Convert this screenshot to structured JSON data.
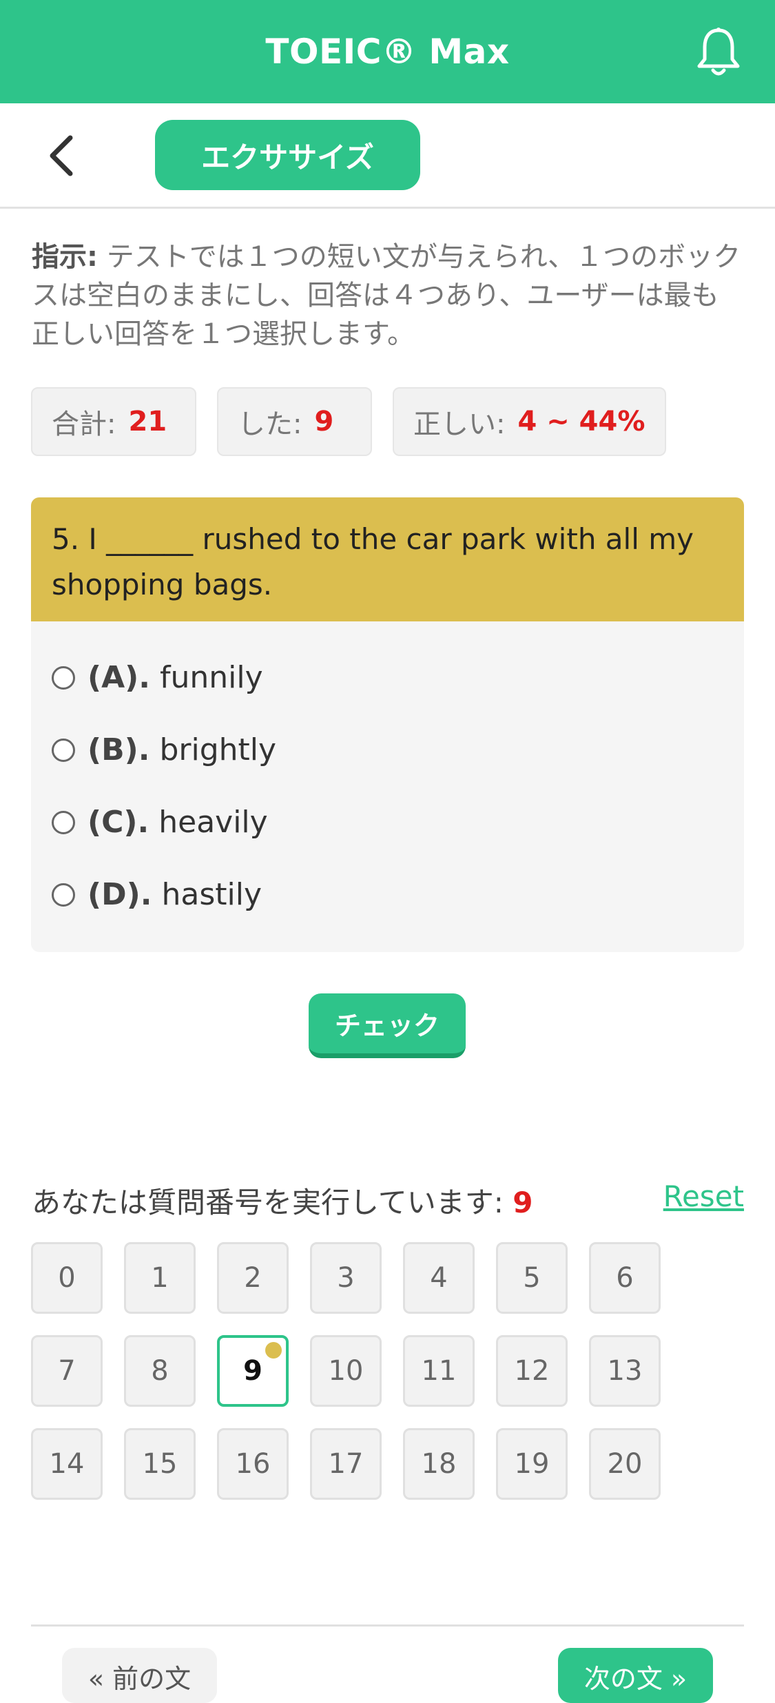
{
  "header": {
    "title": "TOEIC® Max",
    "bell_icon": "bell-icon"
  },
  "nav": {
    "back_icon": "chevron-left-icon",
    "tab_label": "エクササイズ"
  },
  "instructions": {
    "label": "指示:",
    "text": "テストでは１つの短い文が与えられ、１つのボックスは空白のままにし、回答は４つあり、ユーザーは最も正しい回答を１つ選択します。"
  },
  "stats": {
    "total_label": "合計:",
    "total_value": "21",
    "done_label": "した:",
    "done_value": "9",
    "correct_label": "正しい:",
    "correct_value": "4 ~ 44%"
  },
  "question": {
    "text": "5. I ______ rushed to the car park with all my shopping bags.",
    "options": [
      {
        "letter": "(A).",
        "text": "funnily"
      },
      {
        "letter": "(B).",
        "text": "brightly"
      },
      {
        "letter": "(C).",
        "text": "heavily"
      },
      {
        "letter": "(D).",
        "text": "hastily"
      }
    ]
  },
  "check_label": "チェック",
  "progress": {
    "running_label": "あなたは質問番号を実行しています:",
    "current": "9",
    "reset_label": "Reset",
    "numbers": [
      "0",
      "1",
      "2",
      "3",
      "4",
      "5",
      "6",
      "7",
      "8",
      "9",
      "10",
      "11",
      "12",
      "13",
      "14",
      "15",
      "16",
      "17",
      "18",
      "19",
      "20"
    ]
  },
  "footer": {
    "prev_label": "« 前の文",
    "next_label": "次の文 »"
  },
  "colors": {
    "brand": "#2ec48a",
    "question_bg": "#dbbe4f",
    "accent_red": "#e01e1e"
  }
}
